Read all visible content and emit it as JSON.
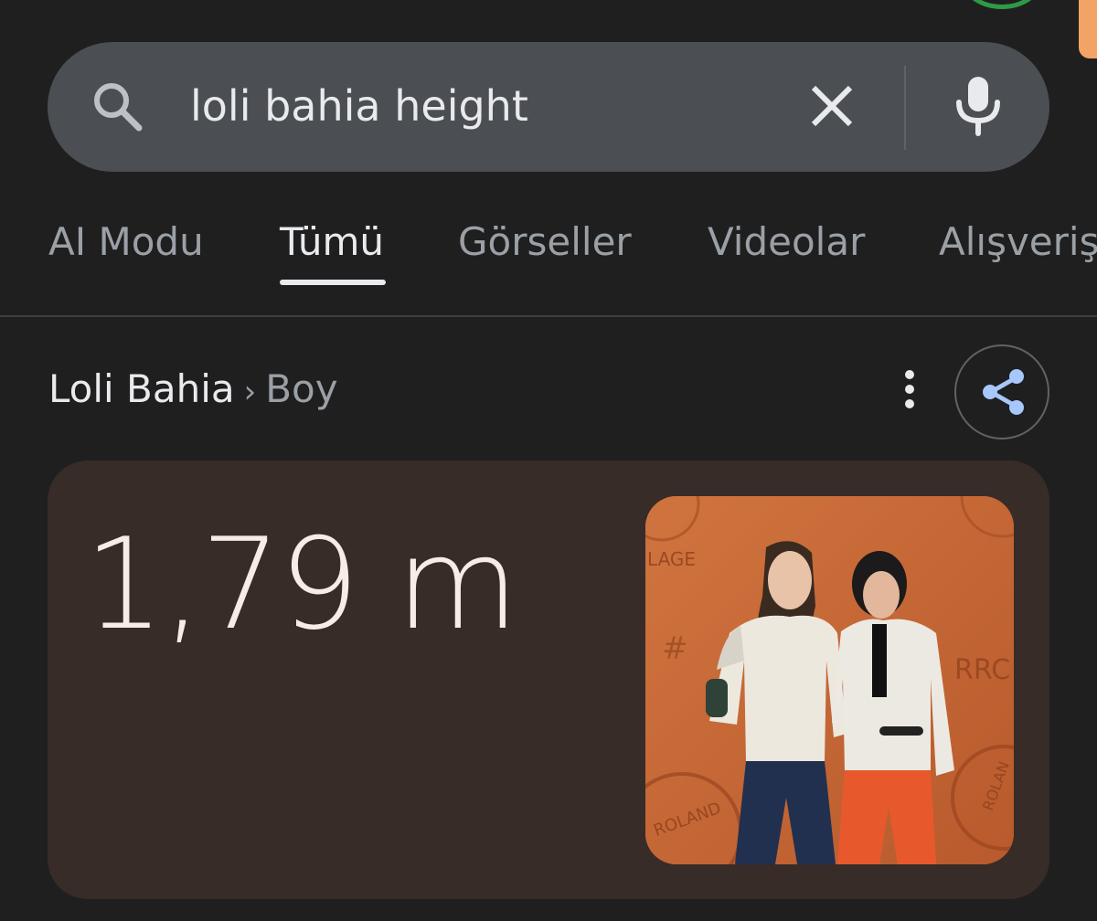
{
  "search": {
    "query": "loli bahia height"
  },
  "tabs": [
    {
      "label": "AI Modu"
    },
    {
      "label": "Tümü"
    },
    {
      "label": "Görseller"
    },
    {
      "label": "Videolar"
    },
    {
      "label": "Alışveriş"
    }
  ],
  "breadcrumb": {
    "entity": "Loli Bahia",
    "separator": "›",
    "attribute": "Boy"
  },
  "answer": {
    "value": "1,79 m"
  },
  "photo": {
    "backdrop_texts": [
      "LAGE",
      "#",
      "RRC",
      "ROLAND",
      "ROLAN"
    ]
  },
  "icons": {
    "search": "search-icon",
    "clear": "close-icon",
    "mic": "microphone-icon",
    "more": "more-vert-icon",
    "share": "share-icon"
  },
  "colors": {
    "background": "#1f1f1f",
    "search_bar": "#4b4e52",
    "card": "#372c28",
    "share_accent": "#a8c7fa",
    "active_tab": "#e8eaed",
    "inactive_tab": "#9aa0a6"
  }
}
